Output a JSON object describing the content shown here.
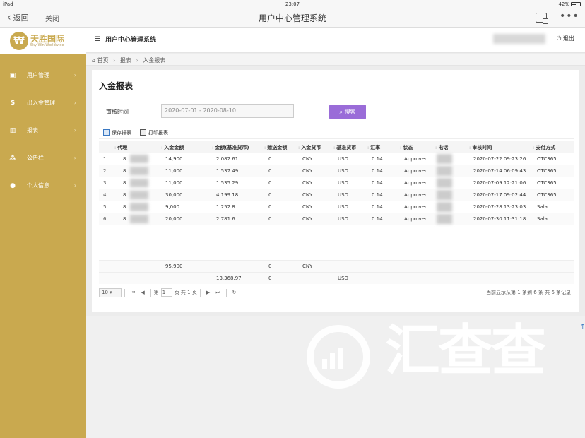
{
  "statusbar": {
    "device": "iPad",
    "time": "23:07",
    "battery": "42%"
  },
  "navbar": {
    "back": "返回",
    "close": "关闭",
    "title": "用户中心管理系统"
  },
  "logo": {
    "main": "天胜国际",
    "sub": "Sky Win Worldwide"
  },
  "sidebar": {
    "items": [
      {
        "label": "用户管理",
        "icon": "user-icon"
      },
      {
        "label": "出入金管理",
        "icon": "dollar-icon"
      },
      {
        "label": "报表",
        "icon": "chart-icon"
      },
      {
        "label": "公告栏",
        "icon": "people-icon"
      },
      {
        "label": "个人信息",
        "icon": "person-icon"
      }
    ]
  },
  "topbar": {
    "title": "用户中心管理系统",
    "logout": "退出"
  },
  "breadcrumb": {
    "home": "首页",
    "level1": "报表",
    "level2": "入金报表"
  },
  "page": {
    "title": "入金报表",
    "filter_label": "审核时间",
    "date_range": "2020-07-01 - 2020-08-10",
    "search_label": "搜索",
    "save_label": "保存报表",
    "print_label": "打印报表"
  },
  "table": {
    "headers": [
      "代理",
      "入金金额",
      "金额(基准货币)",
      "赠送金额",
      "入金货币",
      "基准货币",
      "汇率",
      "状态",
      "电话",
      "审核时间",
      "支付方式"
    ],
    "rows": [
      {
        "n": "1",
        "agent": "8",
        "amount": "14,900",
        "base": "2,082.61",
        "bonus": "0",
        "cur": "CNY",
        "basecur": "USD",
        "rate": "0.14",
        "status": "Approved",
        "time": "2020-07-22 09:23:26",
        "pay": "OTC365"
      },
      {
        "n": "2",
        "agent": "8",
        "amount": "11,000",
        "base": "1,537.49",
        "bonus": "0",
        "cur": "CNY",
        "basecur": "USD",
        "rate": "0.14",
        "status": "Approved",
        "time": "2020-07-14 06:09:43",
        "pay": "OTC365"
      },
      {
        "n": "3",
        "agent": "8",
        "amount": "11,000",
        "base": "1,535.29",
        "bonus": "0",
        "cur": "CNY",
        "basecur": "USD",
        "rate": "0.14",
        "status": "Approved",
        "time": "2020-07-09 12:21:06",
        "pay": "OTC365"
      },
      {
        "n": "4",
        "agent": "8",
        "amount": "30,000",
        "base": "4,199.18",
        "bonus": "0",
        "cur": "CNY",
        "basecur": "USD",
        "rate": "0.14",
        "status": "Approved",
        "time": "2020-07-17 09:02:44",
        "pay": "OTC365"
      },
      {
        "n": "5",
        "agent": "8",
        "amount": "9,000",
        "base": "1,252.8",
        "bonus": "0",
        "cur": "CNY",
        "basecur": "USD",
        "rate": "0.14",
        "status": "Approved",
        "time": "2020-07-28 13:23:03",
        "pay": "Sala"
      },
      {
        "n": "6",
        "agent": "8",
        "amount": "20,000",
        "base": "2,781.6",
        "bonus": "0",
        "cur": "CNY",
        "basecur": "USD",
        "rate": "0.14",
        "status": "Approved",
        "time": "2020-07-30 11:31:18",
        "pay": "Sala"
      }
    ],
    "summary1": {
      "amount": "95,900",
      "bonus": "0",
      "cur": "CNY"
    },
    "summary2": {
      "base": "13,368.97",
      "bonus": "0",
      "basecur": "USD"
    }
  },
  "pager": {
    "page_size": "10",
    "page_prefix": "第",
    "page_value": "1",
    "page_suffix": "页 共 1 页",
    "info": "当前显示从第 1 条到 6 条 共 6 条记录"
  },
  "watermark": {
    "text": "汇查查"
  }
}
